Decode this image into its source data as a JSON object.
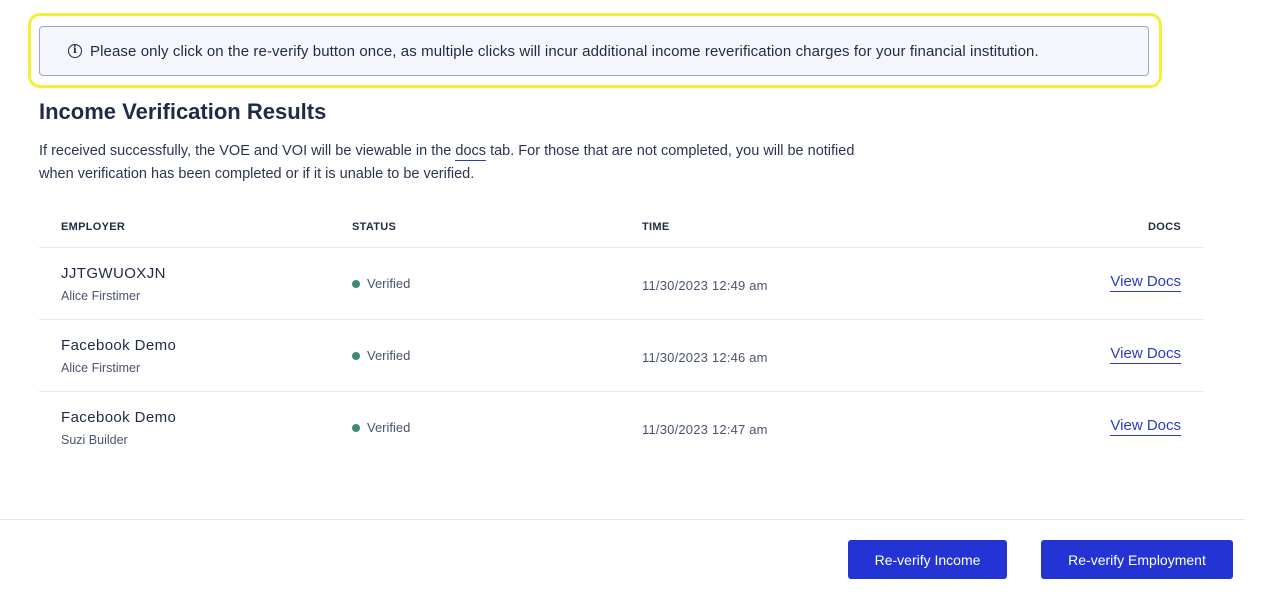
{
  "notice": {
    "icon": "info-icon",
    "text": "Please only click on the re-verify button once, as multiple clicks will incur additional income reverification charges for your financial institution.",
    "highlight_color": "#f4f03a"
  },
  "header": {
    "title": "Income Verification Results",
    "desc_before": "If received successfully, the VOE and VOI will be viewable in the ",
    "desc_link": "docs",
    "desc_after": " tab. For those that are not completed, you will be notified when verification has been completed or if it is unable to be verified."
  },
  "table": {
    "columns": {
      "employer": "EMPLOYER",
      "status": "STATUS",
      "time": "TIME",
      "docs": "DOCS"
    },
    "rows": [
      {
        "employer": "JJTGWUOXJN",
        "person": "Alice Firstimer",
        "status": "Verified",
        "time": "11/30/2023 12:49 am",
        "docs": "View Docs"
      },
      {
        "employer": "Facebook Demo",
        "person": "Alice Firstimer",
        "status": "Verified",
        "time": "11/30/2023 12:46 am",
        "docs": "View Docs"
      },
      {
        "employer": "Facebook Demo",
        "person": "Suzi Builder",
        "status": "Verified",
        "time": "11/30/2023 12:47 am",
        "docs": "View Docs"
      }
    ],
    "status_color": "#3b8a77"
  },
  "actions": {
    "reverify_income": "Re-verify Income",
    "reverify_employment": "Re-verify Employment",
    "button_color": "#2434d4"
  }
}
